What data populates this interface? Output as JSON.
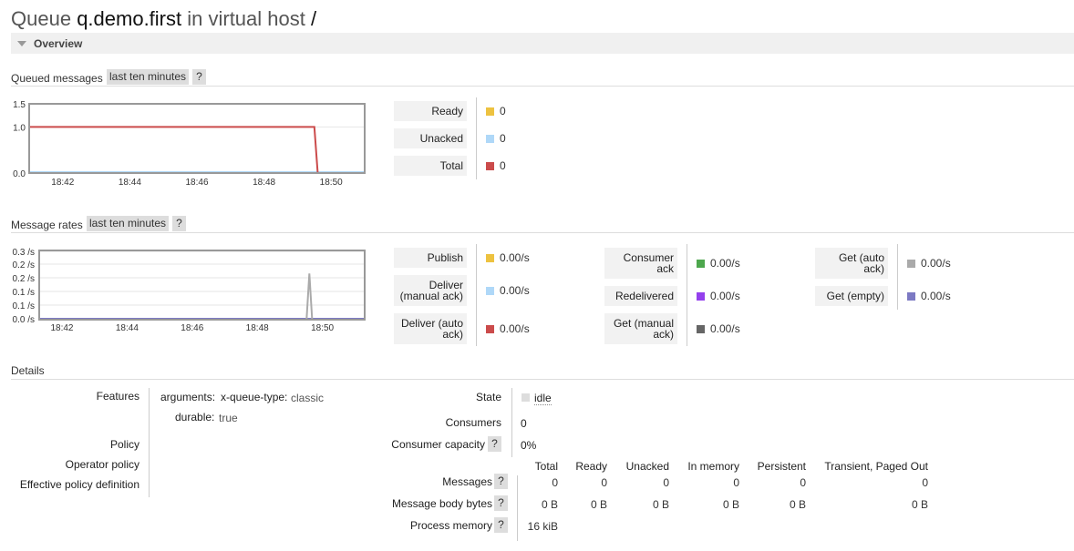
{
  "page": {
    "title_prefix": "Queue",
    "queue_name": "q.demo.first",
    "title_mid": "in virtual host",
    "vhost": "/"
  },
  "overview": {
    "label": "Overview"
  },
  "queued": {
    "header": "Queued messages",
    "range": "last ten minutes",
    "help": "?",
    "chart": {
      "y_ticks": [
        "1.5",
        "1.0",
        "0.0"
      ],
      "x_ticks": [
        "18:42",
        "18:44",
        "18:46",
        "18:48",
        "18:50"
      ],
      "series_total": [
        {
          "t": "18:41",
          "v": 1.0
        },
        {
          "t": "18:49.5",
          "v": 1.0
        },
        {
          "t": "18:49.6",
          "v": 0.0
        },
        {
          "t": "18:51",
          "v": 0.0
        }
      ]
    },
    "legend": [
      {
        "label": "Ready",
        "value": "0",
        "color": "#edc240"
      },
      {
        "label": "Unacked",
        "value": "0",
        "color": "#afd8f8"
      },
      {
        "label": "Total",
        "value": "0",
        "color": "#cb4b4b"
      }
    ]
  },
  "rates": {
    "header": "Message rates",
    "range": "last ten minutes",
    "help": "?",
    "chart": {
      "y_ticks": [
        "0.3 /s",
        "0.2 /s",
        "0.2 /s",
        "0.1 /s",
        "0.1 /s",
        "0.0 /s"
      ],
      "x_ticks": [
        "18:42",
        "18:44",
        "18:46",
        "18:48",
        "18:50"
      ],
      "spike": {
        "t": "18:49.6",
        "v": 0.2
      }
    },
    "col1": [
      {
        "label": "Publish",
        "value": "0.00/s",
        "color": "#edc240"
      },
      {
        "label": "Deliver (manual ack)",
        "value": "0.00/s",
        "color": "#afd8f8"
      },
      {
        "label": "Deliver (auto ack)",
        "value": "0.00/s",
        "color": "#cb4b4b"
      }
    ],
    "col2": [
      {
        "label": "Consumer ack",
        "value": "0.00/s",
        "color": "#4da74d"
      },
      {
        "label": "Redelivered",
        "value": "0.00/s",
        "color": "#9440ed"
      },
      {
        "label": "Get (manual ack)",
        "value": "0.00/s",
        "color": "#666666"
      }
    ],
    "col3": [
      {
        "label": "Get (auto ack)",
        "value": "0.00/s",
        "color": "#aaaaaa"
      },
      {
        "label": "Get (empty)",
        "value": "0.00/s",
        "color": "#7c79c3"
      }
    ]
  },
  "details": {
    "header": "Details",
    "features_label": "Features",
    "arguments_label": "arguments:",
    "arg_key": "x-queue-type:",
    "arg_val": "classic",
    "durable_label": "durable:",
    "durable_val": "true",
    "policy_label": "Policy",
    "operator_policy_label": "Operator policy",
    "effective_policy_label": "Effective policy definition",
    "state_label": "State",
    "state_value": "idle",
    "consumers_label": "Consumers",
    "consumers_value": "0",
    "capacity_label": "Consumer capacity",
    "capacity_value": "0%",
    "help": "?",
    "table_headers": [
      "Total",
      "Ready",
      "Unacked",
      "In memory",
      "Persistent",
      "Transient, Paged Out"
    ],
    "messages_label": "Messages",
    "messages_values": [
      "0",
      "0",
      "0",
      "0",
      "0",
      "0"
    ],
    "body_label": "Message body bytes",
    "body_values": [
      "0 B",
      "0 B",
      "0 B",
      "0 B",
      "0 B",
      "0 B"
    ],
    "process_label": "Process memory",
    "process_value": "16 kiB"
  }
}
